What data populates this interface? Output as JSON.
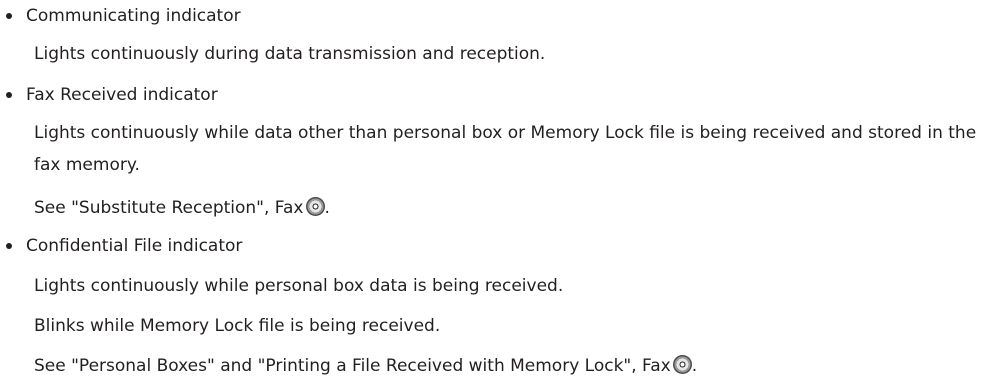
{
  "items": [
    {
      "title": "Communicating indicator",
      "lines": [
        "Lights continuously during data transmission and reception."
      ]
    },
    {
      "title": "Fax Received indicator",
      "lines": [
        "Lights continuously while data other than personal box or Memory Lock file is being received and stored in the fax memory."
      ],
      "see_text": "See \"Substitute Reception\", Fax",
      "see_suffix": ".",
      "see_icon": "cd-manual-icon"
    },
    {
      "title": "Confidential File indicator",
      "lines": [
        "Lights continuously while personal box data is being received.",
        "Blinks while Memory Lock file is being received."
      ],
      "see_text": "See \"Personal Boxes\" and \"Printing a File Received with Memory Lock\", Fax",
      "see_suffix": ".",
      "see_icon": "cd-manual-icon"
    }
  ]
}
